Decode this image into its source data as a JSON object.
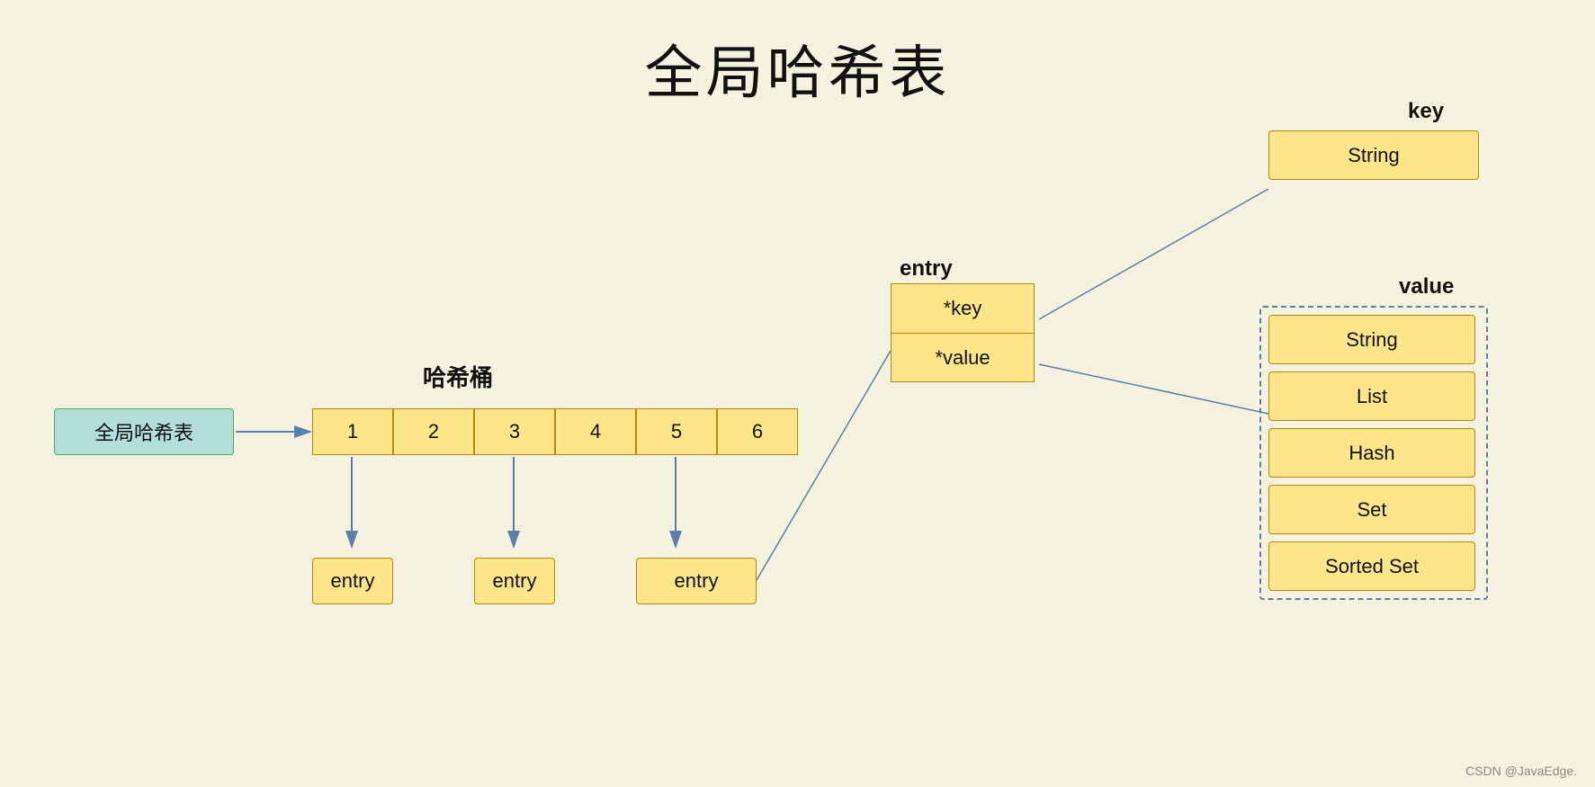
{
  "title": "全局哈希表",
  "watermark": "CSDN @JavaEdge.",
  "globalHashLabel": "全局哈希表",
  "bucketLabel": "哈希桶",
  "entryLabel": "entry",
  "bucketCells": [
    "1",
    "2",
    "3",
    "4",
    "5",
    "6"
  ],
  "entryBoxes": [
    "entry",
    "entry",
    "entry"
  ],
  "entryDetail": {
    "row1": "*key",
    "row2": "*value"
  },
  "keyLabel": "key",
  "keyType": "String",
  "valueLabel": "value",
  "valueTypes": [
    "String",
    "List",
    "Hash",
    "Set",
    "Sorted Set"
  ]
}
